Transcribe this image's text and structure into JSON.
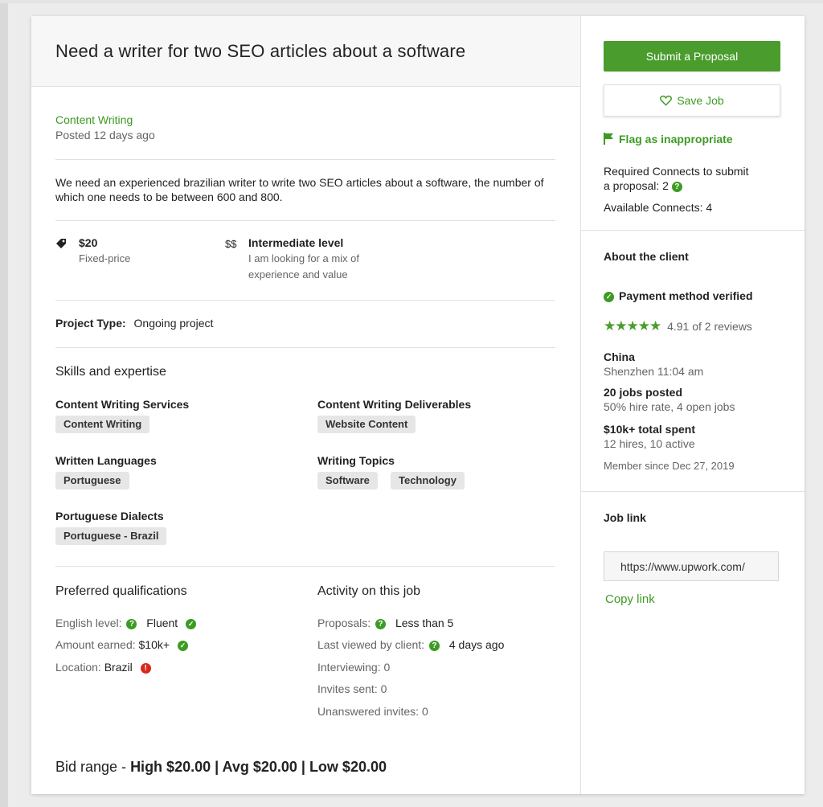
{
  "job": {
    "title": "Need a writer for two SEO articles about a software",
    "category": "Content Writing",
    "posted": "Posted 12 days ago",
    "description": "We need an experienced brazilian writer to write two SEO articles about a software, the number of which one needs to be between 600 and 800.",
    "price": "$20",
    "price_type": "Fixed-price",
    "level_icon": "$$",
    "level": "Intermediate level",
    "level_desc_1": "I am looking for a mix of",
    "level_desc_2": "experience and value",
    "project_type_label": "Project Type:",
    "project_type_value": "Ongoing project"
  },
  "skills": {
    "title": "Skills and expertise",
    "groups": [
      {
        "name": "Content Writing Services",
        "chips": [
          "Content Writing"
        ]
      },
      {
        "name": "Content Writing Deliverables",
        "chips": [
          "Website Content"
        ]
      },
      {
        "name": "Written Languages",
        "chips": [
          "Portuguese"
        ]
      },
      {
        "name": "Writing Topics",
        "chips": [
          "Software",
          "Technology"
        ]
      },
      {
        "name": "Portuguese Dialects",
        "chips": [
          "Portuguese - Brazil"
        ]
      }
    ]
  },
  "qualifications": {
    "title": "Preferred qualifications",
    "english_label": "English level:",
    "english_value": "Fluent",
    "amount_label": "Amount earned:",
    "amount_value": "$10k+",
    "location_label": "Location:",
    "location_value": "Brazil"
  },
  "activity": {
    "title": "Activity on this job",
    "proposals_label": "Proposals:",
    "proposals_value": "Less than 5",
    "viewed_label": "Last viewed by client:",
    "viewed_value": "4 days ago",
    "interviewing": "Interviewing: 0",
    "invites": "Invites sent: 0",
    "unanswered": "Unanswered invites: 0"
  },
  "bid": {
    "prefix": "Bid range - ",
    "high": "High $20.00",
    "sep1": " | ",
    "avg": "Avg $20.00",
    "sep2": " | ",
    "low": "Low $20.00"
  },
  "sidebar": {
    "submit_label": "Submit a Proposal",
    "save_label": "Save Job",
    "flag_label": "Flag as inappropriate",
    "connects_line1": "Required Connects to submit",
    "connects_line2": "a proposal: 2",
    "available": "Available Connects: 4"
  },
  "client": {
    "title": "About the client",
    "payment": "Payment method verified",
    "rating": "4.91 of 2 reviews",
    "stars": 5,
    "country": "China",
    "city_time": "Shenzhen 11:04 am",
    "jobs_posted": "20 jobs posted",
    "hire_rate": "50% hire rate, 4 open jobs",
    "spent": "$10k+ total spent",
    "hires": "12 hires, 10 active",
    "member_since": "Member since Dec 27, 2019"
  },
  "job_link": {
    "title": "Job link",
    "url": "https://www.upwork.com/",
    "copy_label": "Copy link"
  },
  "colors": {
    "accent": "#3c9b22",
    "button": "#4a9c2d",
    "alert": "#d92818"
  }
}
